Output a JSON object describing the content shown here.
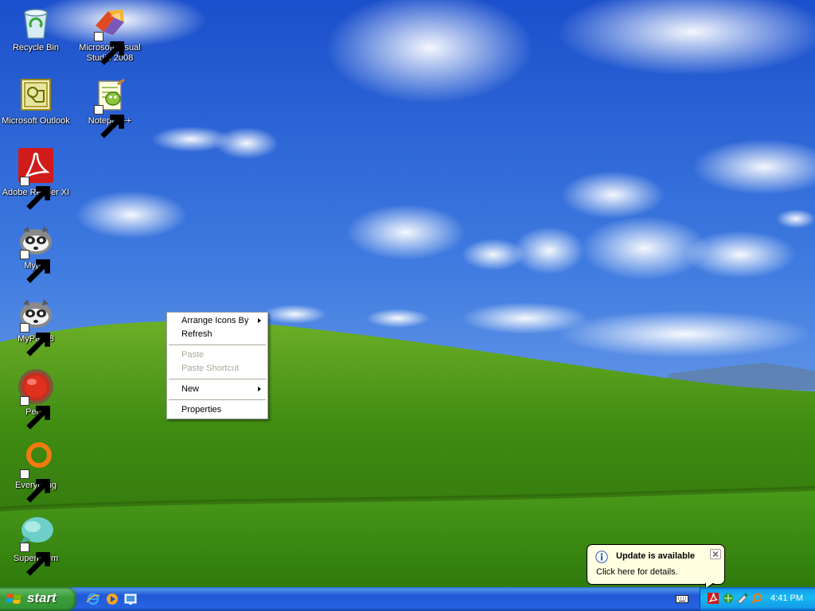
{
  "desktop": {
    "icons": [
      {
        "label": "Recycle Bin",
        "icon": "recycle-bin-icon"
      },
      {
        "label": "Microsoft Visual Studio 2008",
        "icon": "visual-studio-icon"
      },
      {
        "label": "Microsoft Outlook",
        "icon": "outlook-icon"
      },
      {
        "label": "Notepad++",
        "icon": "notepad-plus-plus-icon"
      },
      {
        "label": "Adobe Reader XI",
        "icon": "adobe-reader-icon"
      },
      {
        "label": "Mypal",
        "icon": "mypal-icon"
      },
      {
        "label": "MyPal 68",
        "icon": "mypal-68-icon"
      },
      {
        "label": "Pego",
        "icon": "pego-icon"
      },
      {
        "label": "Everything",
        "icon": "everything-icon"
      },
      {
        "label": "Supermium",
        "icon": "supermium-icon"
      }
    ]
  },
  "context_menu": {
    "items": [
      {
        "label": "Arrange Icons By",
        "submenu": true,
        "enabled": true
      },
      {
        "label": "Refresh",
        "submenu": false,
        "enabled": true
      },
      {
        "label": "Paste",
        "submenu": false,
        "enabled": false
      },
      {
        "label": "Paste Shortcut",
        "submenu": false,
        "enabled": false
      },
      {
        "label": "New",
        "submenu": true,
        "enabled": true
      },
      {
        "label": "Properties",
        "submenu": false,
        "enabled": true
      }
    ]
  },
  "balloon": {
    "title": "Update is available",
    "body": "Click here for details.",
    "icon": "info-icon"
  },
  "taskbar": {
    "start_label": "start",
    "quick_launch": [
      "internet-explorer-icon",
      "media-player-icon",
      "show-desktop-icon"
    ],
    "tray_icons": [
      "adobe-update-icon",
      "network-icon",
      "safely-remove-icon",
      "everything-tray-icon"
    ],
    "clock": "4:41 PM"
  },
  "colors": {
    "taskbar_blue": "#2457d6",
    "start_green": "#3c9b3c",
    "tray_blue": "#139ee9",
    "balloon_bg": "#ffffe1"
  }
}
